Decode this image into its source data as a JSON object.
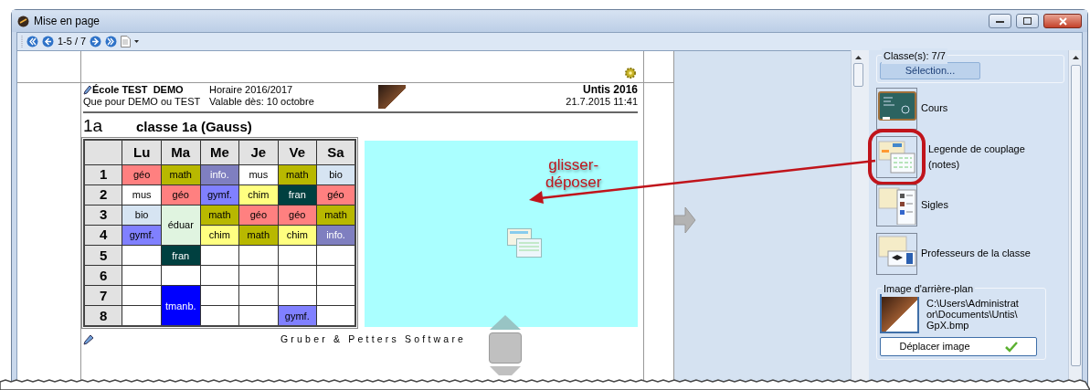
{
  "window": {
    "title": "Mise en page"
  },
  "toolbar": {
    "page_range": "1-5 / 7"
  },
  "page": {
    "school": "École TEST  DEMO",
    "subtitle": "Que pour DEMO ou TEST",
    "schedule": "Horaire 2016/2017",
    "valid_from": "Valable dès: 10 octobre",
    "product": "Untis 2016",
    "timestamp": "21.7.2015 11:41",
    "class_code": "1a",
    "class_name": "classe 1a (Gauss)",
    "footer": "Gruber & Petters Software",
    "timetable": {
      "columns": [
        "Lu",
        "Ma",
        "Me",
        "Je",
        "Ve",
        "Sa"
      ],
      "rows": [
        {
          "period": "1",
          "cells": [
            {
              "text": "géo",
              "color": "#ff8080"
            },
            {
              "text": "math",
              "color": "#b8b800"
            },
            {
              "text": "info.",
              "color": "#7f7fc0"
            },
            {
              "text": "mus",
              "color": "#ffffff"
            },
            {
              "text": "math",
              "color": "#b8b800"
            },
            {
              "text": "bio",
              "color": "#d6e4f2"
            }
          ]
        },
        {
          "period": "2",
          "cells": [
            {
              "text": "mus",
              "color": "#ffffff"
            },
            {
              "text": "géo",
              "color": "#ff8080"
            },
            {
              "text": "gymf.",
              "color": "#8080ff"
            },
            {
              "text": "chim",
              "color": "#ffff80"
            },
            {
              "text": "fran",
              "color": "#004040"
            },
            {
              "text": "géo",
              "color": "#ff8080"
            }
          ]
        },
        {
          "period": "3",
          "cells": [
            {
              "text": "bio",
              "color": "#d6e4f2"
            },
            {
              "text": "éduar",
              "color": "#e0f4e0",
              "rowspan": 2
            },
            {
              "text": "math",
              "color": "#b8b800"
            },
            {
              "text": "géo",
              "color": "#ff8080"
            },
            {
              "text": "géo",
              "color": "#ff8080"
            },
            {
              "text": "math",
              "color": "#b8b800"
            }
          ]
        },
        {
          "period": "4",
          "cells": [
            {
              "text": "gymf.",
              "color": "#8080ff"
            },
            {
              "text": "chim",
              "color": "#ffff80"
            },
            {
              "text": "math",
              "color": "#b8b800"
            },
            {
              "text": "chim",
              "color": "#ffff80"
            },
            {
              "text": "info.",
              "color": "#7f7fc0"
            }
          ]
        },
        {
          "period": "5",
          "cells": [
            {},
            {
              "text": "fran",
              "color": "#004040"
            },
            {},
            {},
            {},
            {}
          ]
        },
        {
          "period": "6",
          "cells": [
            {},
            {},
            {},
            {},
            {},
            {}
          ]
        },
        {
          "period": "7",
          "cells": [
            {},
            {
              "text": "tmanb.",
              "color": "#0000ff",
              "rowspan": 2
            },
            {},
            {},
            {},
            {}
          ]
        },
        {
          "period": "8",
          "cells": [
            {},
            {},
            {},
            {
              "text": "gymf.",
              "color": "#8080ff"
            },
            {}
          ]
        }
      ]
    }
  },
  "annotation": {
    "lines": [
      "glisser-",
      "déposer"
    ]
  },
  "side_panel": {
    "classes_label": "Classe(s): 7/7",
    "selection_button": "Sélection...",
    "items": [
      {
        "label": "Cours",
        "kind": "chalkboard",
        "highlighted": false
      },
      {
        "label": "Legende de couplage (notes)",
        "kind": "legend",
        "highlighted": true
      },
      {
        "label": "Sigles",
        "kind": "codes",
        "highlighted": false
      },
      {
        "label": "Professeurs de la classe",
        "kind": "teachers",
        "highlighted": false
      }
    ],
    "background": {
      "label": "Image d'arrière-plan",
      "path_lines": [
        "C:\\Users\\Administrat",
        "or\\Documents\\Untis\\",
        "GpX.bmp"
      ],
      "move_button": "Déplacer image",
      "move_checked": true
    }
  }
}
